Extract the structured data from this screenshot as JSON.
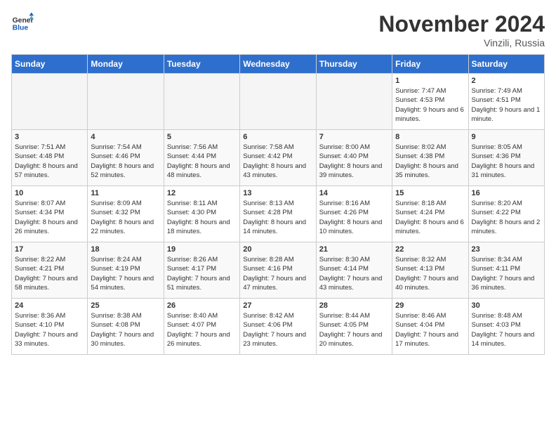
{
  "header": {
    "logo_general": "General",
    "logo_blue": "Blue",
    "month_title": "November 2024",
    "location": "Vinzili, Russia"
  },
  "weekdays": [
    "Sunday",
    "Monday",
    "Tuesday",
    "Wednesday",
    "Thursday",
    "Friday",
    "Saturday"
  ],
  "weeks": [
    [
      {
        "day": "",
        "sunrise": "",
        "sunset": "",
        "daylight": "",
        "empty": true
      },
      {
        "day": "",
        "sunrise": "",
        "sunset": "",
        "daylight": "",
        "empty": true
      },
      {
        "day": "",
        "sunrise": "",
        "sunset": "",
        "daylight": "",
        "empty": true
      },
      {
        "day": "",
        "sunrise": "",
        "sunset": "",
        "daylight": "",
        "empty": true
      },
      {
        "day": "",
        "sunrise": "",
        "sunset": "",
        "daylight": "",
        "empty": true
      },
      {
        "day": "1",
        "sunrise": "Sunrise: 7:47 AM",
        "sunset": "Sunset: 4:53 PM",
        "daylight": "Daylight: 9 hours and 6 minutes.",
        "empty": false
      },
      {
        "day": "2",
        "sunrise": "Sunrise: 7:49 AM",
        "sunset": "Sunset: 4:51 PM",
        "daylight": "Daylight: 9 hours and 1 minute.",
        "empty": false
      }
    ],
    [
      {
        "day": "3",
        "sunrise": "Sunrise: 7:51 AM",
        "sunset": "Sunset: 4:48 PM",
        "daylight": "Daylight: 8 hours and 57 minutes.",
        "empty": false
      },
      {
        "day": "4",
        "sunrise": "Sunrise: 7:54 AM",
        "sunset": "Sunset: 4:46 PM",
        "daylight": "Daylight: 8 hours and 52 minutes.",
        "empty": false
      },
      {
        "day": "5",
        "sunrise": "Sunrise: 7:56 AM",
        "sunset": "Sunset: 4:44 PM",
        "daylight": "Daylight: 8 hours and 48 minutes.",
        "empty": false
      },
      {
        "day": "6",
        "sunrise": "Sunrise: 7:58 AM",
        "sunset": "Sunset: 4:42 PM",
        "daylight": "Daylight: 8 hours and 43 minutes.",
        "empty": false
      },
      {
        "day": "7",
        "sunrise": "Sunrise: 8:00 AM",
        "sunset": "Sunset: 4:40 PM",
        "daylight": "Daylight: 8 hours and 39 minutes.",
        "empty": false
      },
      {
        "day": "8",
        "sunrise": "Sunrise: 8:02 AM",
        "sunset": "Sunset: 4:38 PM",
        "daylight": "Daylight: 8 hours and 35 minutes.",
        "empty": false
      },
      {
        "day": "9",
        "sunrise": "Sunrise: 8:05 AM",
        "sunset": "Sunset: 4:36 PM",
        "daylight": "Daylight: 8 hours and 31 minutes.",
        "empty": false
      }
    ],
    [
      {
        "day": "10",
        "sunrise": "Sunrise: 8:07 AM",
        "sunset": "Sunset: 4:34 PM",
        "daylight": "Daylight: 8 hours and 26 minutes.",
        "empty": false
      },
      {
        "day": "11",
        "sunrise": "Sunrise: 8:09 AM",
        "sunset": "Sunset: 4:32 PM",
        "daylight": "Daylight: 8 hours and 22 minutes.",
        "empty": false
      },
      {
        "day": "12",
        "sunrise": "Sunrise: 8:11 AM",
        "sunset": "Sunset: 4:30 PM",
        "daylight": "Daylight: 8 hours and 18 minutes.",
        "empty": false
      },
      {
        "day": "13",
        "sunrise": "Sunrise: 8:13 AM",
        "sunset": "Sunset: 4:28 PM",
        "daylight": "Daylight: 8 hours and 14 minutes.",
        "empty": false
      },
      {
        "day": "14",
        "sunrise": "Sunrise: 8:16 AM",
        "sunset": "Sunset: 4:26 PM",
        "daylight": "Daylight: 8 hours and 10 minutes.",
        "empty": false
      },
      {
        "day": "15",
        "sunrise": "Sunrise: 8:18 AM",
        "sunset": "Sunset: 4:24 PM",
        "daylight": "Daylight: 8 hours and 6 minutes.",
        "empty": false
      },
      {
        "day": "16",
        "sunrise": "Sunrise: 8:20 AM",
        "sunset": "Sunset: 4:22 PM",
        "daylight": "Daylight: 8 hours and 2 minutes.",
        "empty": false
      }
    ],
    [
      {
        "day": "17",
        "sunrise": "Sunrise: 8:22 AM",
        "sunset": "Sunset: 4:21 PM",
        "daylight": "Daylight: 7 hours and 58 minutes.",
        "empty": false
      },
      {
        "day": "18",
        "sunrise": "Sunrise: 8:24 AM",
        "sunset": "Sunset: 4:19 PM",
        "daylight": "Daylight: 7 hours and 54 minutes.",
        "empty": false
      },
      {
        "day": "19",
        "sunrise": "Sunrise: 8:26 AM",
        "sunset": "Sunset: 4:17 PM",
        "daylight": "Daylight: 7 hours and 51 minutes.",
        "empty": false
      },
      {
        "day": "20",
        "sunrise": "Sunrise: 8:28 AM",
        "sunset": "Sunset: 4:16 PM",
        "daylight": "Daylight: 7 hours and 47 minutes.",
        "empty": false
      },
      {
        "day": "21",
        "sunrise": "Sunrise: 8:30 AM",
        "sunset": "Sunset: 4:14 PM",
        "daylight": "Daylight: 7 hours and 43 minutes.",
        "empty": false
      },
      {
        "day": "22",
        "sunrise": "Sunrise: 8:32 AM",
        "sunset": "Sunset: 4:13 PM",
        "daylight": "Daylight: 7 hours and 40 minutes.",
        "empty": false
      },
      {
        "day": "23",
        "sunrise": "Sunrise: 8:34 AM",
        "sunset": "Sunset: 4:11 PM",
        "daylight": "Daylight: 7 hours and 36 minutes.",
        "empty": false
      }
    ],
    [
      {
        "day": "24",
        "sunrise": "Sunrise: 8:36 AM",
        "sunset": "Sunset: 4:10 PM",
        "daylight": "Daylight: 7 hours and 33 minutes.",
        "empty": false
      },
      {
        "day": "25",
        "sunrise": "Sunrise: 8:38 AM",
        "sunset": "Sunset: 4:08 PM",
        "daylight": "Daylight: 7 hours and 30 minutes.",
        "empty": false
      },
      {
        "day": "26",
        "sunrise": "Sunrise: 8:40 AM",
        "sunset": "Sunset: 4:07 PM",
        "daylight": "Daylight: 7 hours and 26 minutes.",
        "empty": false
      },
      {
        "day": "27",
        "sunrise": "Sunrise: 8:42 AM",
        "sunset": "Sunset: 4:06 PM",
        "daylight": "Daylight: 7 hours and 23 minutes.",
        "empty": false
      },
      {
        "day": "28",
        "sunrise": "Sunrise: 8:44 AM",
        "sunset": "Sunset: 4:05 PM",
        "daylight": "Daylight: 7 hours and 20 minutes.",
        "empty": false
      },
      {
        "day": "29",
        "sunrise": "Sunrise: 8:46 AM",
        "sunset": "Sunset: 4:04 PM",
        "daylight": "Daylight: 7 hours and 17 minutes.",
        "empty": false
      },
      {
        "day": "30",
        "sunrise": "Sunrise: 8:48 AM",
        "sunset": "Sunset: 4:03 PM",
        "daylight": "Daylight: 7 hours and 14 minutes.",
        "empty": false
      }
    ]
  ]
}
